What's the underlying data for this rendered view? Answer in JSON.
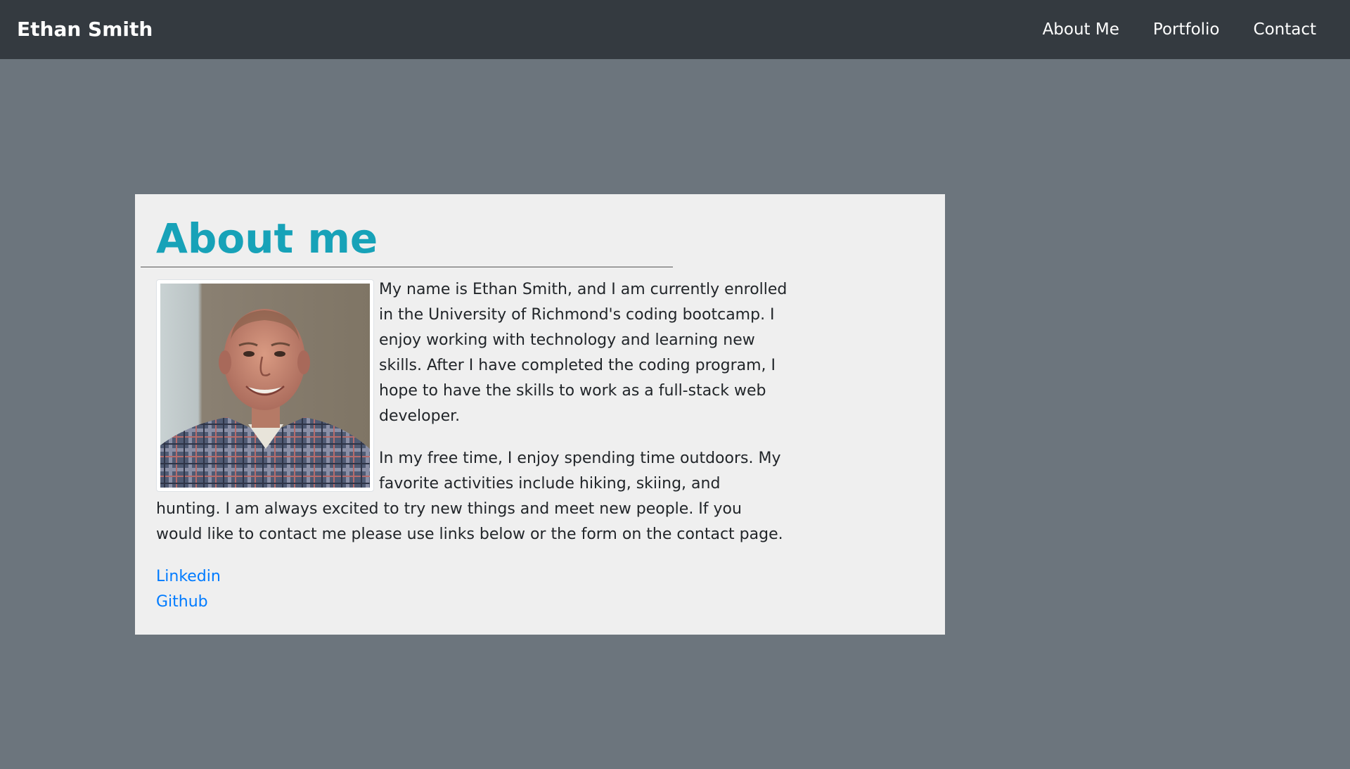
{
  "navbar": {
    "brand": "Ethan Smith",
    "links": [
      "About Me",
      "Portfolio",
      "Contact"
    ]
  },
  "about": {
    "title": "About me",
    "photo_icon": "profile-photo",
    "paragraphs": [
      "My name is Ethan Smith, and I am currently enrolled in the University of Richmond's coding bootcamp. I enjoy working with technology and learning new skills. After I have completed the coding program, I hope to have the skills to work as a full-stack web developer.",
      "In my free time, I enjoy spending time outdoors. My favorite activities include hiking, skiing, and hunting. I am always excited to try new things and meet new people. If you would like to contact me please use links below or the form on the contact page."
    ],
    "links": [
      "Linkedin",
      "Github"
    ]
  },
  "colors": {
    "navbar_bg": "#343a40",
    "page_bg": "#6c757d",
    "card_bg": "#efefef",
    "heading": "#17a2b8",
    "link": "#007bff"
  }
}
